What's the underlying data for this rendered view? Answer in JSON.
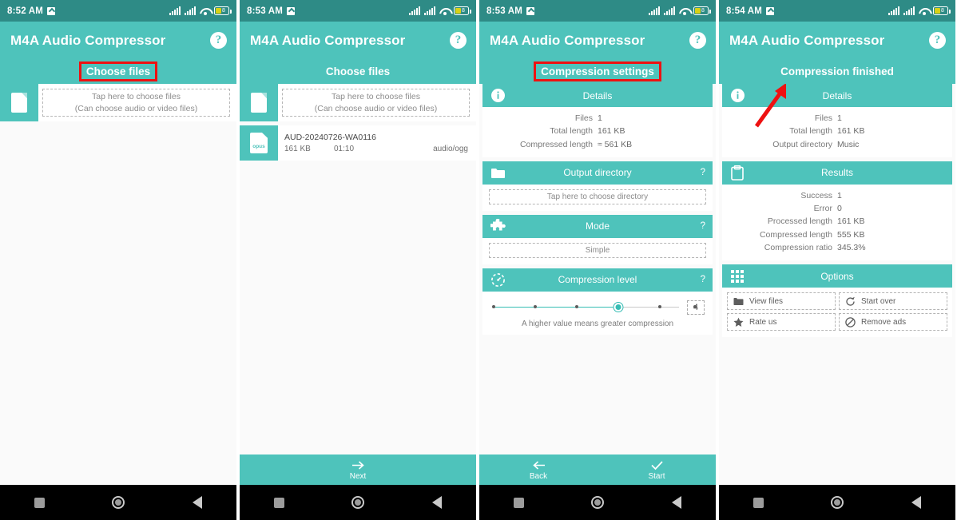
{
  "app": {
    "title": "M4A Audio Compressor",
    "help_label": "?",
    "accent_color": "#4ec3bb",
    "statusbar_color": "#2e8b86",
    "highlight_color": "#ee1111"
  },
  "screens": [
    {
      "id": "choose-files-empty",
      "status": {
        "time": "8:52 AM",
        "battery": "8"
      },
      "subtitle": "Choose files",
      "subtitle_highlighted": true,
      "chooser": {
        "icon": "document-icon",
        "line1": "Tap here to choose files",
        "line2": "(Can choose audio or video files)"
      },
      "files": [],
      "actions": []
    },
    {
      "id": "choose-files-with-file",
      "status": {
        "time": "8:53 AM",
        "battery": "8"
      },
      "subtitle": "Choose files",
      "subtitle_highlighted": false,
      "chooser": {
        "icon": "document-icon",
        "line1": "Tap here to choose files",
        "line2": "(Can choose audio or video files)"
      },
      "files": [
        {
          "format": "opus",
          "name": "AUD-20240726-WA0116",
          "size": "161 KB",
          "duration": "01:10",
          "mime": "audio/ogg"
        }
      ],
      "actions": [
        {
          "icon": "arrow-right-icon",
          "label": "Next"
        }
      ]
    },
    {
      "id": "compression-settings",
      "status": {
        "time": "8:53 AM",
        "battery": "8"
      },
      "subtitle": "Compression settings",
      "subtitle_highlighted": true,
      "cards": [
        {
          "id": "details",
          "icon": "info-icon",
          "title": "Details",
          "help": "",
          "rows": [
            {
              "key": "Files",
              "value": "1"
            },
            {
              "key": "Total length",
              "value": "161 KB"
            },
            {
              "key": "Compressed length",
              "value": "≈ 561 KB"
            }
          ]
        },
        {
          "id": "output-directory",
          "icon": "folder-icon",
          "title": "Output directory",
          "help": "?",
          "input_value": "Tap here to choose directory"
        },
        {
          "id": "mode",
          "icon": "puzzle-icon",
          "title": "Mode",
          "help": "?",
          "input_value": "Simple"
        },
        {
          "id": "compression-level",
          "icon": "gauge-icon",
          "title": "Compression level",
          "help": "?",
          "slider": {
            "value": 4,
            "min": 1,
            "max": 6,
            "ticks": 6,
            "display_value": "4"
          },
          "hint": "A higher value means greater compression"
        }
      ],
      "actions": [
        {
          "icon": "arrow-left-icon",
          "label": "Back"
        },
        {
          "icon": "check-icon",
          "label": "Start"
        }
      ]
    },
    {
      "id": "compression-finished",
      "status": {
        "time": "8:54 AM",
        "battery": "8"
      },
      "subtitle": "Compression finished",
      "subtitle_highlighted": false,
      "cards": [
        {
          "id": "details",
          "icon": "info-icon",
          "title": "Details",
          "help": "",
          "rows": [
            {
              "key": "Files",
              "value": "1"
            },
            {
              "key": "Total length",
              "value": "161 KB"
            },
            {
              "key": "Output directory",
              "value": "Music"
            }
          ]
        },
        {
          "id": "results",
          "icon": "clipboard-icon",
          "title": "Results",
          "help": "",
          "rows": [
            {
              "key": "Success",
              "value": "1"
            },
            {
              "key": "Error",
              "value": "0"
            },
            {
              "key": "Processed length",
              "value": "161 KB"
            },
            {
              "key": "Compressed length",
              "value": "555 KB"
            },
            {
              "key": "Compression ratio",
              "value": "345.3%"
            }
          ]
        },
        {
          "id": "options",
          "icon": "grid-icon",
          "title": "Options",
          "help": "",
          "options": [
            {
              "icon": "folder-icon",
              "label": "View files"
            },
            {
              "icon": "refresh-icon",
              "label": "Start over"
            },
            {
              "icon": "star-icon",
              "label": "Rate us"
            },
            {
              "icon": "block-icon",
              "label": "Remove ads"
            }
          ]
        }
      ],
      "actions": []
    }
  ]
}
